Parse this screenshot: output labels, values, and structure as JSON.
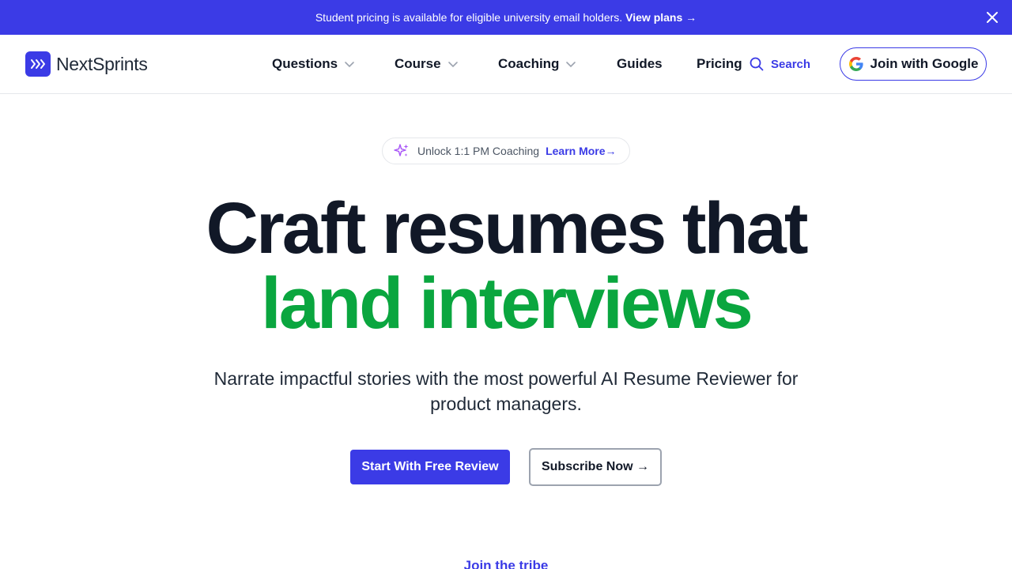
{
  "announcement": {
    "message": "Student pricing is available for eligible university email holders.",
    "link_label": "View plans →"
  },
  "brand": {
    "name": "NextSprints",
    "accent_color": "#3b3be6"
  },
  "nav": {
    "items": [
      {
        "label": "Questions",
        "has_dropdown": true
      },
      {
        "label": "Course",
        "has_dropdown": true
      },
      {
        "label": "Coaching",
        "has_dropdown": true
      },
      {
        "label": "Guides",
        "has_dropdown": false
      },
      {
        "label": "Pricing",
        "has_dropdown": false
      }
    ],
    "search_label": "Search",
    "google_button_label": "Join with Google"
  },
  "hero": {
    "pill_text": "Unlock 1:1 PM Coaching",
    "pill_link": "Learn More→",
    "title_line1": "Craft resumes that",
    "title_line2": "land interviews",
    "title_line2_color": "#0aa63f",
    "subtitle": "Narrate impactful stories with the most powerful AI Resume Reviewer for product managers.",
    "primary_cta": "Start With Free Review",
    "secondary_cta": "Subscribe Now →"
  },
  "footer_teaser": {
    "label": "Join the tribe"
  }
}
